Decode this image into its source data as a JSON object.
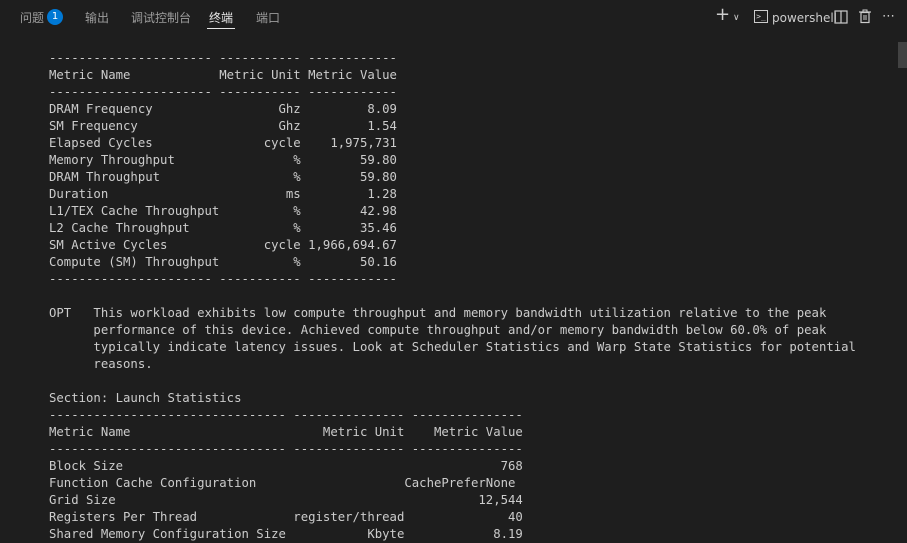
{
  "panel_tabs": [
    {
      "label": "问题",
      "badge": "1"
    },
    {
      "label": "输出"
    },
    {
      "label": "调试控制台"
    },
    {
      "label": "终端",
      "active": true
    },
    {
      "label": "端口"
    }
  ],
  "toolbar": {
    "shell_name": "powershell",
    "add_icon": "plus-icon",
    "dropdown_icon": "chevron-down-icon",
    "shell_icon": "terminal-icon",
    "split_icon": "split-icon",
    "trash_icon": "trash-icon",
    "more_icon": "ellipsis-icon"
  },
  "terminal": {
    "lines": [
      "---------------------- ----------- ------------",
      "Metric Name            Metric Unit Metric Value",
      "---------------------- ----------- ------------",
      "DRAM Frequency                 Ghz         8.09",
      "SM Frequency                   Ghz         1.54",
      "Elapsed Cycles               cycle    1,975,731",
      "Memory Throughput                %        59.80",
      "DRAM Throughput                  %        59.80",
      "Duration                        ms         1.28",
      "L1/TEX Cache Throughput          %        42.98",
      "L2 Cache Throughput              %        35.46",
      "SM Active Cycles             cycle 1,966,694.67",
      "Compute (SM) Throughput          %        50.16",
      "---------------------- ----------- ------------",
      "",
      "OPT   This workload exhibits low compute throughput and memory bandwidth utilization relative to the peak",
      "      performance of this device. Achieved compute throughput and/or memory bandwidth below 60.0% of peak",
      "      typically indicate latency issues. Look at Scheduler Statistics and Warp State Statistics for potential",
      "      reasons.",
      "",
      "Section: Launch Statistics",
      "-------------------------------- --------------- ---------------",
      "Metric Name                          Metric Unit    Metric Value",
      "-------------------------------- --------------- ---------------",
      "Block Size                                                   768",
      "Function Cache Configuration                    CachePreferNone",
      "Grid Size                                                 12,544",
      "Registers Per Thread             register/thread              40",
      "Shared Memory Configuration Size           Kbyte            8.19"
    ]
  }
}
